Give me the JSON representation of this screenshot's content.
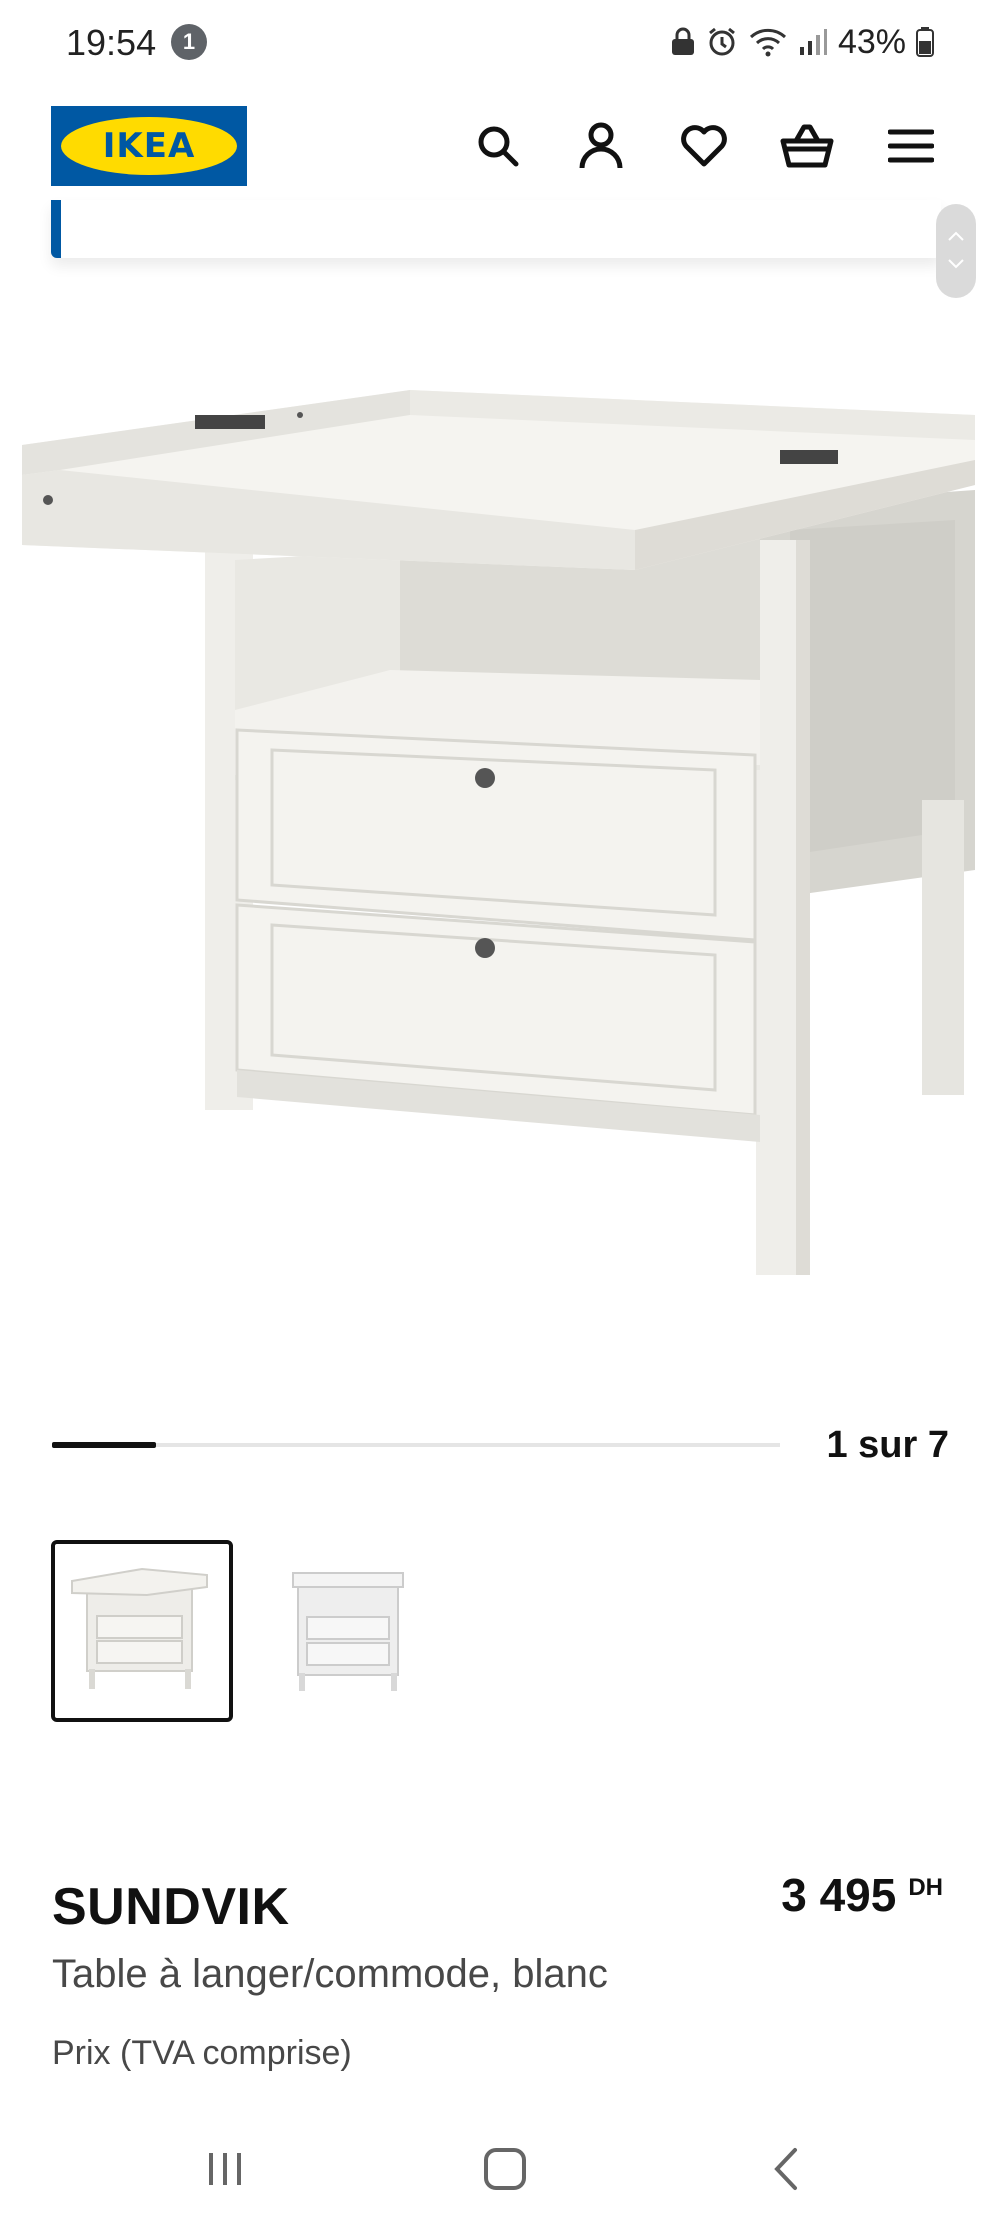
{
  "status_bar": {
    "time": "19:54",
    "notification_count": "1",
    "battery_percent": "43%"
  },
  "header": {
    "logo_text": "IKEA",
    "icons": [
      "search-icon",
      "account-icon",
      "heart-icon",
      "basket-icon",
      "menu-icon"
    ]
  },
  "gallery": {
    "current_page": 1,
    "total_pages": 7,
    "counter_text": "1 sur 7",
    "progress_fraction": 0.143,
    "thumbnails": [
      "thumbnail-1",
      "thumbnail-2"
    ],
    "selected_thumbnail": 0
  },
  "product": {
    "name": "SUNDVIK",
    "description": "Table à langer/commode, blanc",
    "price": "3 495",
    "currency": "DH",
    "price_note": "Prix (TVA comprise)"
  },
  "nav_bar": {
    "buttons": [
      "recents-icon",
      "home-icon",
      "back-icon"
    ]
  },
  "colors": {
    "ikea_blue": "#0058a3",
    "ikea_yellow": "#ffdb00",
    "text": "#111111",
    "muted_text": "#484848"
  }
}
